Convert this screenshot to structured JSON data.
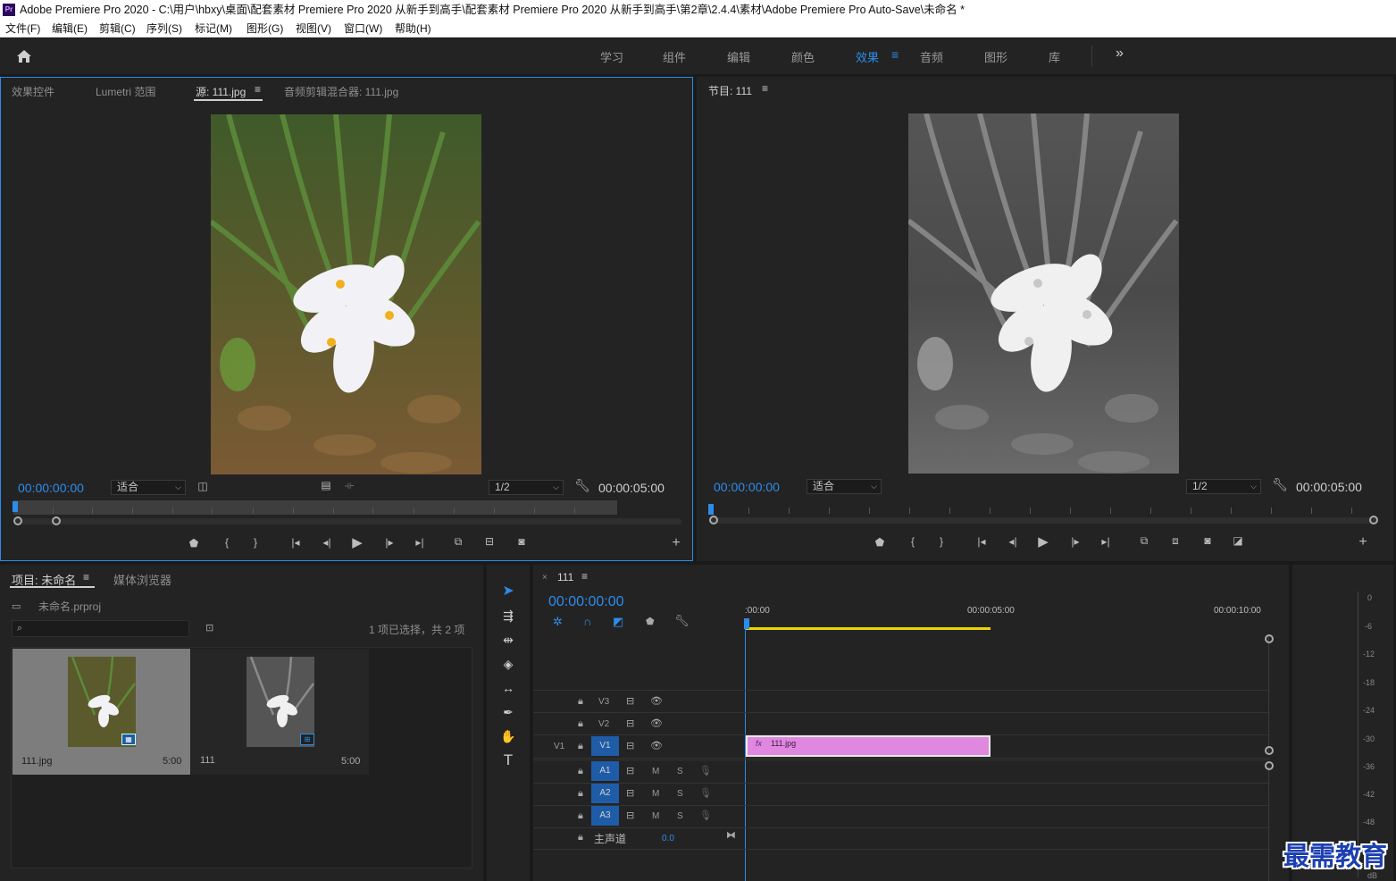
{
  "title_bar": {
    "app_icon": "Pr",
    "title": "Adobe Premiere Pro 2020 - C:\\用户\\hbxy\\桌面\\配套素材 Premiere Pro 2020 从新手到高手\\配套素材 Premiere Pro 2020 从新手到高手\\第2章\\2.4.4\\素材\\Adobe Premiere Pro Auto-Save\\未命名 *"
  },
  "menu": [
    "文件(F)",
    "编辑(E)",
    "剪辑(C)",
    "序列(S)",
    "标记(M)",
    "图形(G)",
    "视图(V)",
    "窗口(W)",
    "帮助(H)"
  ],
  "workspaces": {
    "items": [
      "学习",
      "组件",
      "编辑",
      "颜色",
      "效果",
      "音频",
      "图形",
      "库"
    ],
    "active": "效果",
    "more": "»",
    "menu_icon": "≡"
  },
  "source_monitor": {
    "tabs": [
      "效果控件",
      "Lumetri 范围",
      "源: 111.jpg",
      "音频剪辑混合器: 111.jpg"
    ],
    "active_tab": "源: 111.jpg",
    "timecode_in": "00:00:00:00",
    "fit": "适合",
    "resolution": "1/2",
    "duration": "00:00:05:00"
  },
  "program_monitor": {
    "tab": "节目: 111",
    "timecode_in": "00:00:00:00",
    "fit": "适合",
    "resolution": "1/2",
    "duration": "00:00:05:00"
  },
  "project_panel": {
    "tabs": [
      "项目: 未命名",
      "媒体浏览器"
    ],
    "project_file": "未命名.prproj",
    "selection_info": "1 项已选择，共 2 项",
    "items": [
      {
        "name": "111.jpg",
        "duration": "5:00",
        "selected": true
      },
      {
        "name": "111",
        "duration": "5:00",
        "selected": false
      }
    ]
  },
  "timeline": {
    "close": "×",
    "sequence": "111",
    "timecode": "00:00:00:00",
    "ruler": [
      ":00:00",
      "00:00:05:00",
      "00:00:10:00"
    ],
    "video_tracks": [
      {
        "target": "",
        "name": "V3"
      },
      {
        "target": "",
        "name": "V2"
      },
      {
        "target": "V1",
        "name": "V1"
      }
    ],
    "audio_tracks": [
      {
        "name": "A1",
        "m": "M",
        "s": "S"
      },
      {
        "name": "A2",
        "m": "M",
        "s": "S"
      },
      {
        "name": "A3",
        "m": "M",
        "s": "S"
      }
    ],
    "master": {
      "label": "主声道",
      "value": "0.0"
    },
    "clip": {
      "fx": "fx",
      "name": "111.jpg",
      "color": "#e088e0"
    }
  },
  "audio_meter": {
    "labels": [
      "0",
      "-6",
      "-12",
      "-18",
      "-24",
      "-30",
      "-36",
      "-42",
      "-48",
      "dB"
    ]
  },
  "watermark": "最需教育",
  "colors": {
    "accent_blue": "#2d8ceb",
    "clip_pink": "#e088e0",
    "work_area_yellow": "#e8d600",
    "track_target_blue": "#1f5ca8"
  }
}
